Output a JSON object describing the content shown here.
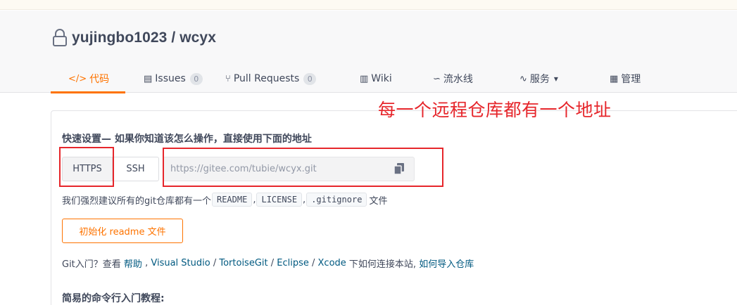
{
  "repo": {
    "owner": "yujingbo1023",
    "separator": " / ",
    "name": "wcyx"
  },
  "tabs": [
    {
      "icon": "</>",
      "label": "代码",
      "active": true
    },
    {
      "icon": "▤",
      "label": "Issues",
      "count": "0"
    },
    {
      "icon": "⑂",
      "label": "Pull Requests",
      "count": "0"
    },
    {
      "icon": "▥",
      "label": "Wiki"
    },
    {
      "icon": "∽",
      "label": "流水线"
    },
    {
      "icon": "∿",
      "label": "服务",
      "dropdown": "▾"
    },
    {
      "icon": "▦",
      "label": "管理"
    }
  ],
  "setup": {
    "title": "快速设置— 如果你知道该怎么操作，直接使用下面的地址",
    "https_label": "HTTPS",
    "ssh_label": "SSH",
    "url": "https://gitee.com/tubie/wcyx.git",
    "recommend_prefix": "我们强烈建议所有的git仓库都有一个",
    "chips": [
      "README",
      "LICENSE",
      ".gitignore"
    ],
    "comma": ",",
    "recommend_suffix": "文件",
    "init_button": "初始化 readme 文件",
    "help": {
      "prefix": "Git入门？查看 ",
      "help_link": "帮助",
      "sep1": " , ",
      "vs_link": "Visual Studio",
      "slash1": " / ",
      "tortoise_link": "TortoiseGit",
      "slash2": " / ",
      "eclipse_link": "Eclipse",
      "slash3": " / ",
      "xcode_link": "Xcode",
      "middle": " 下如何连接本站, ",
      "import_link": "如何导入仓库"
    },
    "tutorial_title": "简易的命令行入门教程:"
  },
  "annotation": {
    "text": "每一个远程仓库都有一个地址",
    "color": "#e6262b"
  },
  "colors": {
    "accent": "#fe7300",
    "link": "#005980",
    "text": "#40485b"
  }
}
